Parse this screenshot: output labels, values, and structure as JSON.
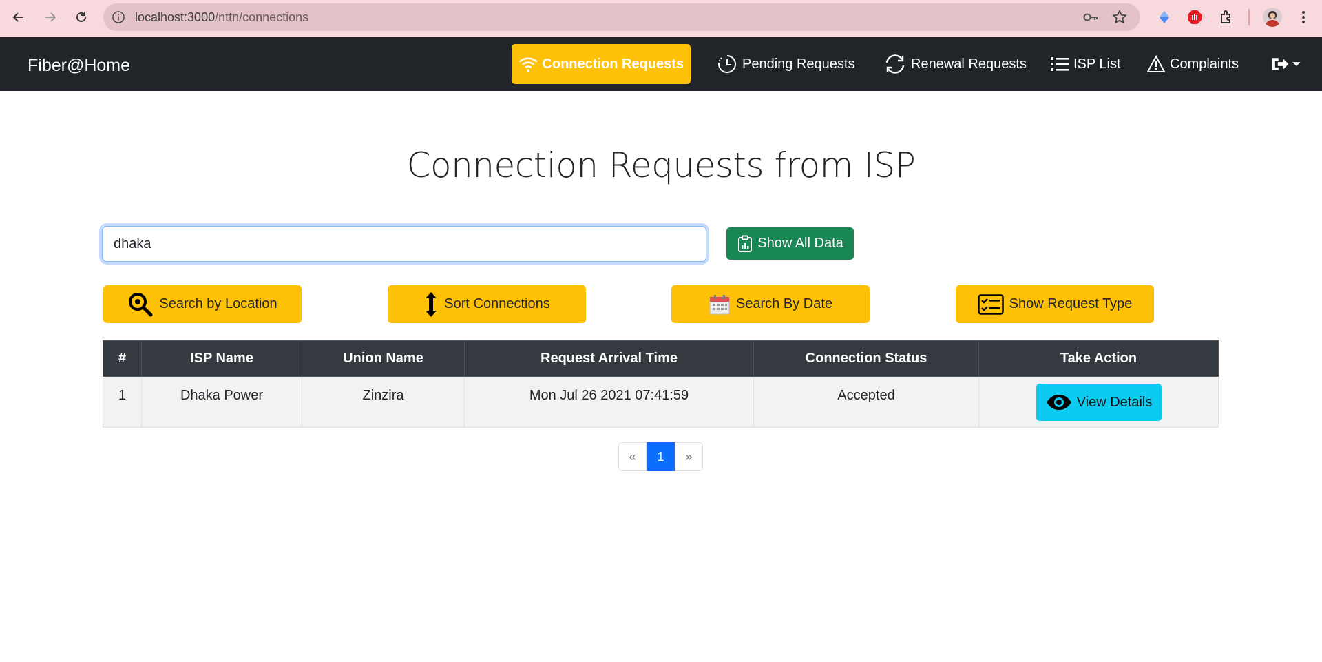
{
  "browser": {
    "url_host": "localhost:3000",
    "url_path": "/nttn/connections"
  },
  "navbar": {
    "brand": "Fiber@Home",
    "items": [
      {
        "label": "Connection Requests",
        "icon": "wifi-icon",
        "active": true
      },
      {
        "label": "Pending Requests",
        "icon": "clock-history-icon",
        "active": false
      },
      {
        "label": "Renewal Requests",
        "icon": "refresh-icon",
        "active": false
      },
      {
        "label": "ISP List",
        "icon": "list-icon",
        "active": false
      },
      {
        "label": "Complaints",
        "icon": "warning-icon",
        "active": false
      }
    ],
    "logout_icon": "logout-icon"
  },
  "main": {
    "title": "Connection Requests from ISP",
    "search_value": "dhaka",
    "show_all_label": "Show All Data",
    "tools": [
      {
        "label": "Search by Location",
        "icon": "search-icon"
      },
      {
        "label": "Sort Connections",
        "icon": "sort-arrows-icon"
      },
      {
        "label": "Search By Date",
        "icon": "calendar-icon"
      },
      {
        "label": "Show Request Type",
        "icon": "checklist-icon"
      }
    ]
  },
  "table": {
    "headers": [
      "#",
      "ISP Name",
      "Union Name",
      "Request Arrival Time",
      "Connection Status",
      "Take Action"
    ],
    "rows": [
      {
        "index": "1",
        "isp_name": "Dhaka Power",
        "union_name": "Zinzira",
        "arrival_time": "Mon Jul 26 2021 07:41:59",
        "status": "Accepted",
        "action_label": "View Details"
      }
    ]
  },
  "pagination": {
    "prev": "«",
    "current": "1",
    "next": "»"
  },
  "colors": {
    "navbar_bg": "#212529",
    "accent_yellow": "#ffc107",
    "success_green": "#198754",
    "info_cyan": "#0dcaf0",
    "primary_blue": "#0d6efd"
  }
}
